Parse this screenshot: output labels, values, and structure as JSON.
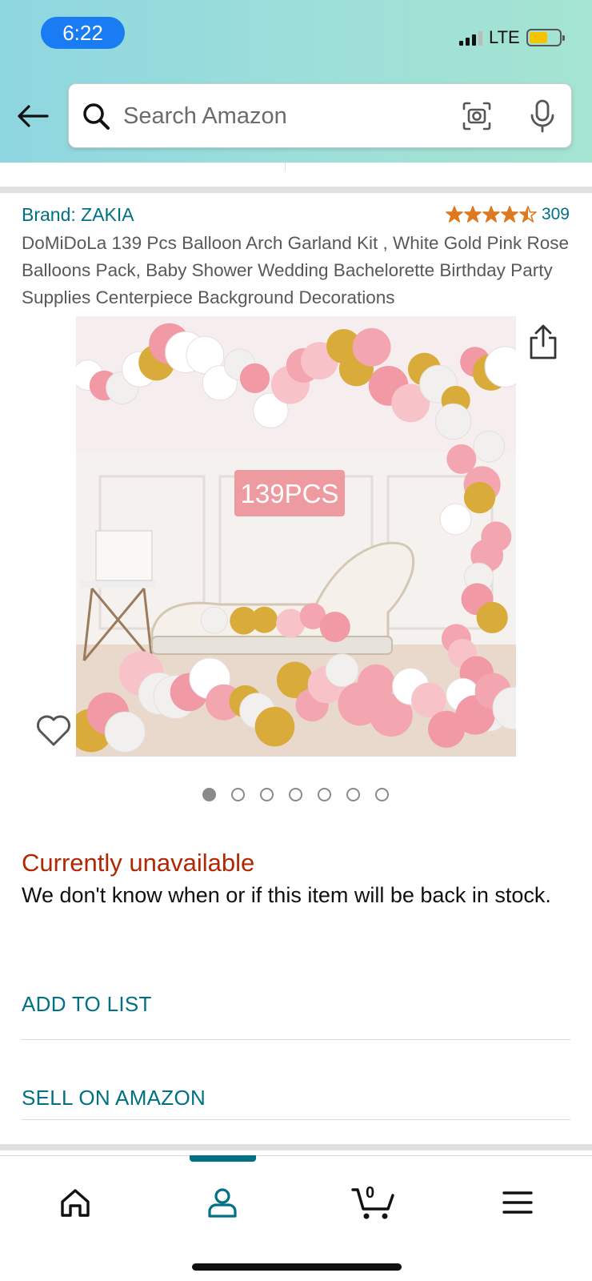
{
  "status_bar": {
    "time": "6:22",
    "network": "LTE",
    "battery_level": 0.62
  },
  "search": {
    "placeholder": "Search Amazon"
  },
  "product": {
    "brand": "Brand: ZAKIA",
    "rating": 4.5,
    "rating_count": "309",
    "title": "DoMiDoLa 139 Pcs Balloon Arch Garland Kit , White Gold Pink Rose Balloons Pack, Baby Shower Wedding Bachelorette Birthday Party Supplies Centerpiece Background Decorations",
    "image_label": "139PCS",
    "image_count": 7,
    "active_image_index": 0
  },
  "availability": {
    "status": "Currently unavailable",
    "message": "We don't know when or if this item will be back in stock."
  },
  "actions": {
    "add_to_list": "ADD TO LIST",
    "sell_on_amazon": "SELL ON AMAZON"
  },
  "bottom_nav": {
    "items": [
      {
        "icon": "home-icon"
      },
      {
        "icon": "account-icon",
        "active": true
      },
      {
        "icon": "cart-icon"
      },
      {
        "icon": "menu-icon"
      }
    ],
    "cart_count": "0"
  },
  "colors": {
    "link": "#007185",
    "unavailable": "#b12704",
    "star": "#de7921",
    "header_gradient_start": "#8ed6e0",
    "header_gradient_end": "#a5e4d1"
  }
}
